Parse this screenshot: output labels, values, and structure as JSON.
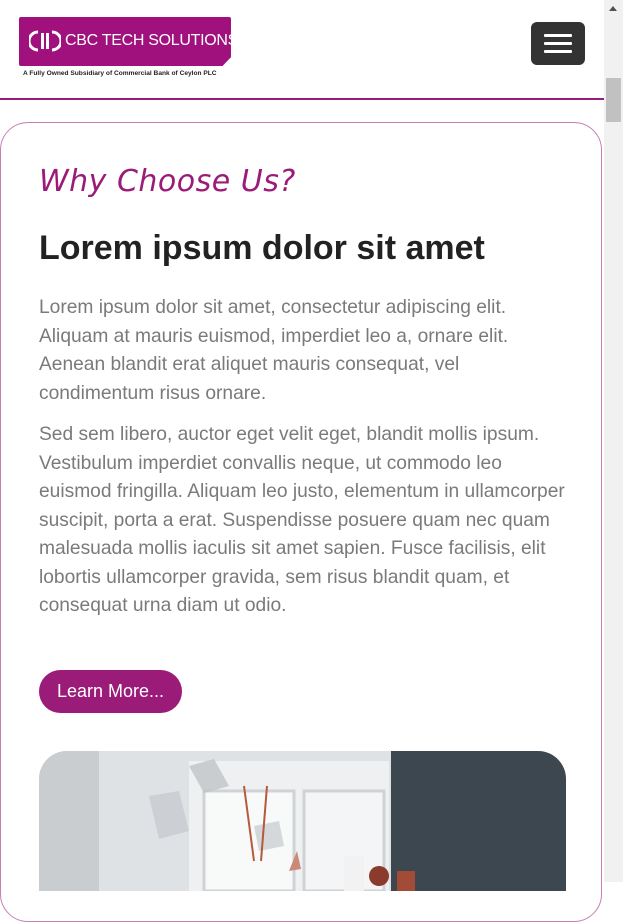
{
  "header": {
    "logo_text": "CBC TECH SOLUTIONS",
    "logo_subtitle": "A Fully Owned Subsidiary of Commercial Bank of Ceylon PLC",
    "menu_icon": "hamburger-menu-icon"
  },
  "section": {
    "eyebrow": "Why Choose Us?",
    "heading": "Lorem ipsum dolor sit amet",
    "paragraph_1": "Lorem ipsum dolor sit amet, consectetur adipiscing elit. Aliquam at mauris euismod, imperdiet leo a, ornare elit. Aenean blandit erat aliquet mauris consequat, vel condimentum risus ornare.",
    "paragraph_2": "Sed sem libero, auctor eget velit eget, blandit mollis ipsum. Vestibulum imperdiet convallis neque, ut commodo leo euismod fringilla. Aliquam leo justo, elementum in ullamcorper suscipit, porta a erat. Suspendisse posuere quam nec quam malesuada mollis iaculis sit amet sapien. Fusce facilisis, elit lobortis ullamcorper gravida, sem risus blandit quam, et consequat urna diam ut odio.",
    "button_label": "Learn More..."
  },
  "colors": {
    "brand": "#9b1b78",
    "heading": "#222222",
    "body_text": "#7a7a7a",
    "menu_button": "#333333"
  }
}
